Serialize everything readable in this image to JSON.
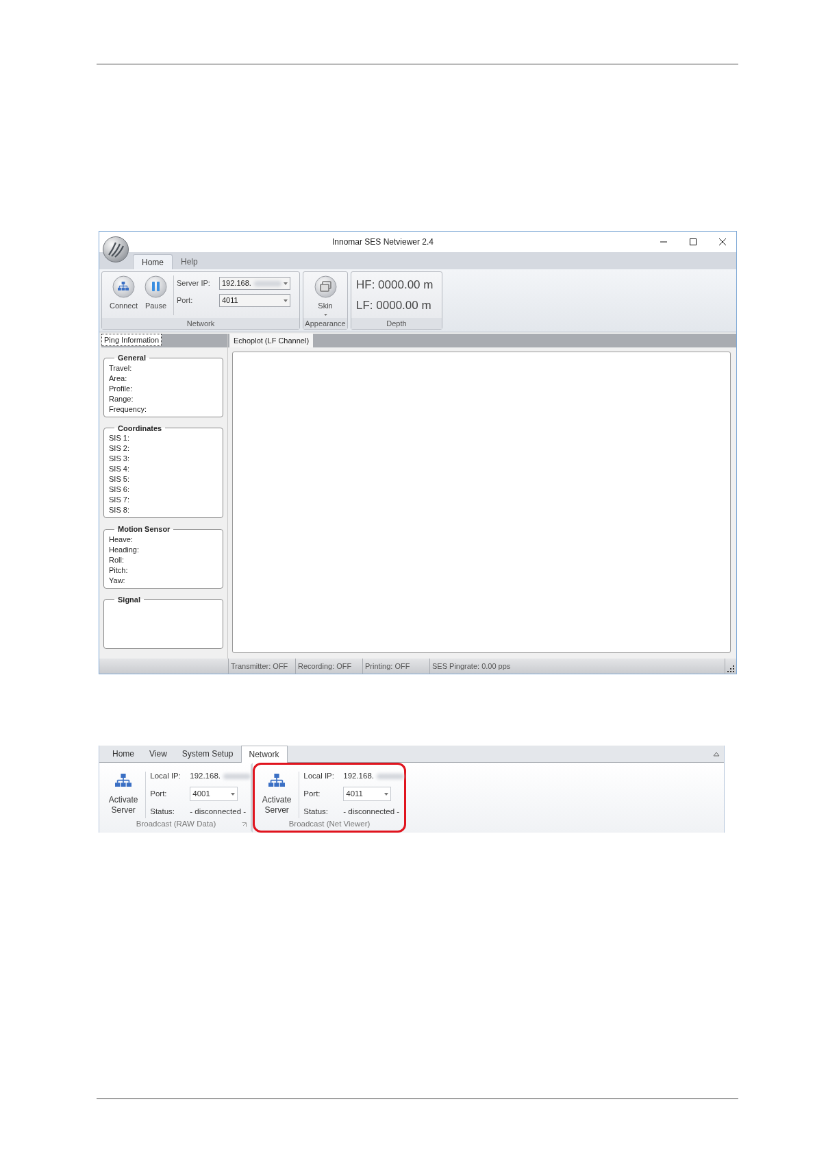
{
  "window": {
    "title": "Innomar SES Netviewer 2.4"
  },
  "menu_tabs": [
    {
      "label": "Home",
      "selected": true
    },
    {
      "label": "Help",
      "selected": false
    }
  ],
  "ribbon": {
    "network": {
      "buttons": [
        {
          "kind": "connect",
          "label": "Connect"
        },
        {
          "kind": "pause",
          "label": "Pause"
        }
      ],
      "fields": [
        {
          "label": "Server IP:",
          "value": "192.168.",
          "blurred": true
        },
        {
          "label": "Port:",
          "value": "4011",
          "blurred": false
        }
      ],
      "label": "Network"
    },
    "appearance": {
      "button": "Skin",
      "label": "Appearance"
    },
    "depth": {
      "readings": [
        "HF: 0000.00 m",
        "LF: 0000.00 m"
      ],
      "label": "Depth"
    }
  },
  "left_tab": {
    "label": "Ping Information",
    "selected": true
  },
  "right_tab": {
    "label": "Echoplot (LF Channel)",
    "selected": true
  },
  "sections": [
    {
      "title": "General",
      "fields": [
        "Travel:",
        "Area:",
        "Profile:",
        "Range:",
        "Frequency:"
      ]
    },
    {
      "title": "Coordinates",
      "fields": [
        "SIS 1:",
        "SIS 2:",
        "SIS 3:",
        "SIS 4:",
        "SIS 5:",
        "SIS 6:",
        "SIS 7:",
        "SIS 8:"
      ]
    },
    {
      "title": "Motion Sensor",
      "fields": [
        "Heave:",
        "Heading:",
        "Roll:",
        "Pitch:",
        "Yaw:"
      ]
    },
    {
      "title": "Signal"
    }
  ],
  "status_bar": [
    "Transmitter: OFF",
    "Recording: OFF",
    "Printing: OFF",
    "SES Pingrate: 0.00 pps"
  ],
  "second": {
    "tabs": [
      {
        "label": "Home",
        "selected": false
      },
      {
        "label": "View",
        "selected": false
      },
      {
        "label": "System Setup",
        "selected": false
      },
      {
        "label": "Network",
        "selected": true
      }
    ],
    "groups": [
      {
        "button": "Activate Server",
        "local_ip_label": "Local IP:",
        "local_ip": "192.168.",
        "port_label": "Port:",
        "port": "4001",
        "status_label": "Status:",
        "status": "- disconnected -",
        "label": "Broadcast (RAW Data)",
        "highlighted": false
      },
      {
        "button": "Activate Server",
        "local_ip_label": "Local IP:",
        "local_ip": "192.168.",
        "port_label": "Port:",
        "port": "4011",
        "status_label": "Status:",
        "status": "- disconnected -",
        "label": "Broadcast (Net Viewer)",
        "highlighted": true
      }
    ]
  }
}
